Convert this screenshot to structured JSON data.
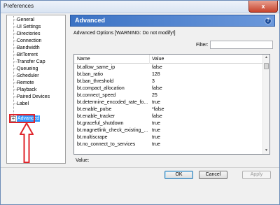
{
  "window": {
    "title": "Preferences",
    "close_symbol": "x"
  },
  "sidebar": {
    "items": [
      {
        "label": "General"
      },
      {
        "label": "UI Settings"
      },
      {
        "label": "Directories"
      },
      {
        "label": "Connection"
      },
      {
        "label": "Bandwidth"
      },
      {
        "label": "BitTorrent"
      },
      {
        "label": "Transfer Cap"
      },
      {
        "label": "Queueing"
      },
      {
        "label": "Scheduler"
      },
      {
        "label": "Remote"
      },
      {
        "label": "Playback"
      },
      {
        "label": "Paired Devices"
      },
      {
        "label": "Label"
      },
      {
        "label": "Advanced",
        "selected": true
      }
    ],
    "expander_symbol": "+"
  },
  "panel": {
    "title": "Advanced",
    "help_symbol": "?",
    "subtitle": "Advanced Options [WARNING: Do not modify!]",
    "filter_label": "Filter:",
    "filter_value": "",
    "columns": {
      "name": "Name",
      "value": "Value"
    },
    "rows": [
      {
        "name": "bt.allow_same_ip",
        "value": "false"
      },
      {
        "name": "bt.ban_ratio",
        "value": "128"
      },
      {
        "name": "bt.ban_threshold",
        "value": "3"
      },
      {
        "name": "bt.compact_allocation",
        "value": "false"
      },
      {
        "name": "bt.connect_speed",
        "value": "25"
      },
      {
        "name": "bt.determine_encoded_rate_fo...",
        "value": "true"
      },
      {
        "name": "bt.enable_pulse",
        "value": "*false"
      },
      {
        "name": "bt.enable_tracker",
        "value": "false"
      },
      {
        "name": "bt.graceful_shutdown",
        "value": "true"
      },
      {
        "name": "bt.magnetlink_check_existing_...",
        "value": "true"
      },
      {
        "name": "bt.multiscrape",
        "value": "true"
      },
      {
        "name": "bt.no_connect_to_services",
        "value": "true"
      }
    ],
    "value_label": "Value:"
  },
  "buttons": {
    "ok": "OK",
    "cancel": "Cancel",
    "apply": "Apply",
    "apply_enabled": false
  },
  "colors": {
    "accent": "#3b72c4",
    "selected": "#3399ff",
    "annotation": "#e0242b"
  }
}
